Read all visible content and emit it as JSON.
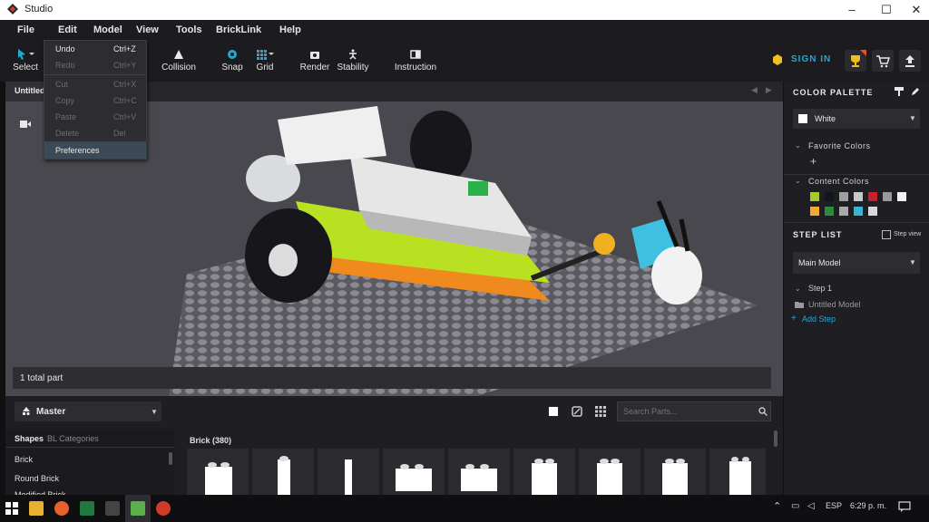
{
  "app": {
    "title": "Studio"
  },
  "menu": [
    "File",
    "Edit",
    "Model",
    "View",
    "Tools",
    "BrickLink",
    "Help"
  ],
  "toolbar": {
    "select": "Select",
    "collision": "Collision",
    "snap": "Snap",
    "grid": "Grid",
    "render": "Render",
    "stability": "Stability",
    "instruction": "Instruction",
    "signin": "SIGN IN"
  },
  "edit_menu": [
    {
      "label": "Undo",
      "shortcut": "Ctrl+Z",
      "enabled": true
    },
    {
      "label": "Redo",
      "shortcut": "Ctrl+Y",
      "enabled": false
    },
    {
      "label": "Cut",
      "shortcut": "Ctrl+X",
      "enabled": false
    },
    {
      "label": "Copy",
      "shortcut": "Ctrl+C",
      "enabled": false
    },
    {
      "label": "Paste",
      "shortcut": "Ctrl+V",
      "enabled": false
    },
    {
      "label": "Delete",
      "shortcut": "Del",
      "enabled": false
    },
    {
      "label": "Preferences",
      "shortcut": "",
      "enabled": true
    }
  ],
  "tab": {
    "label": "Untitled"
  },
  "viewport": {
    "total_parts": "1 total part"
  },
  "palette": {
    "heading": "COLOR PALETTE",
    "selected": "White",
    "favorite": "Favorite Colors",
    "content": "Content Colors",
    "colors": [
      "#a6ca2b",
      "#12171f",
      "#a0a0a0",
      "#c8c8c8",
      "#c8202a",
      "#9a9a9a",
      "#f2f2f2",
      "#f5a83a",
      "#2e8b3d",
      "#a9a9a9",
      "#35b6d6",
      "#d8d8d8"
    ]
  },
  "steplist": {
    "heading": "STEP LIST",
    "stepview": "Step view",
    "model": "Main Model",
    "step": "Step 1",
    "model_item": "Untitled Model",
    "add": "Add Step"
  },
  "parts": {
    "palette": "Master",
    "search_placeholder": "Search Parts...",
    "tabs": [
      "Shapes",
      "BL Categories"
    ],
    "categories": [
      "Brick",
      "Round Brick",
      "Modified Brick"
    ],
    "grid_title": "Brick (380)"
  },
  "taskbar": {
    "lang": "ESP",
    "time": "6:29 p. m."
  },
  "accent": "#23a8d6"
}
